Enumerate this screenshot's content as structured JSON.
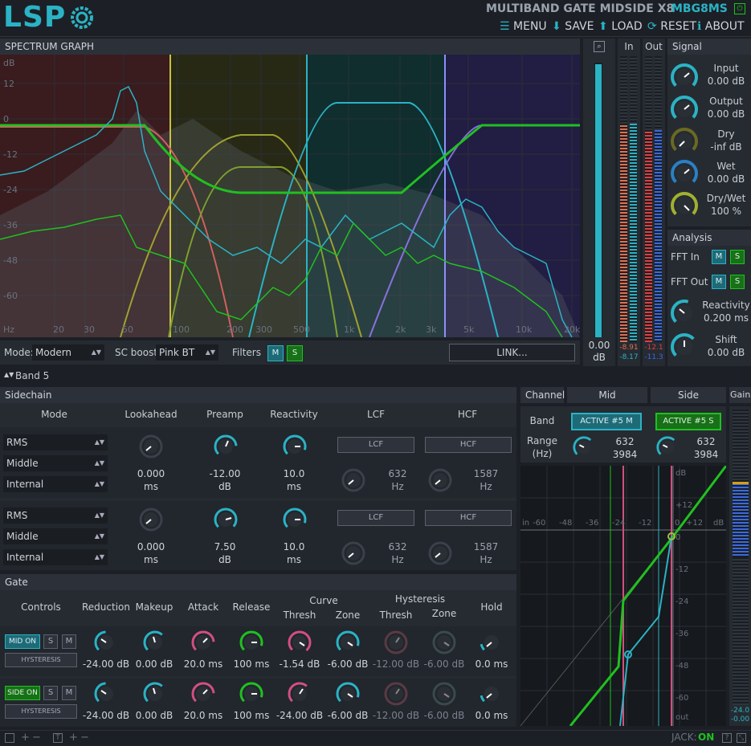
{
  "app": {
    "logo": "LSP",
    "title": "MULTIBAND GATE MIDSIDE X8",
    "code": "MBG8MS"
  },
  "menu": {
    "menu": "MENU",
    "save": "SAVE",
    "load": "LOAD",
    "reset": "RESET",
    "about": "ABOUT"
  },
  "graph": {
    "title": "SPECTRUM GRAPH",
    "db_unit": "dB",
    "y_ticks": [
      "12",
      "0",
      "-12",
      "-24",
      "-36",
      "-48",
      "-60"
    ],
    "hz_unit": "Hz",
    "x_ticks": [
      "20",
      "30",
      "50",
      "100",
      "200",
      "300",
      "500",
      "1k",
      "2k",
      "3k",
      "5k",
      "10k",
      "20k"
    ]
  },
  "gain_meter": {
    "value": "0.00",
    "unit": "dB"
  },
  "meters": {
    "in_label": "In",
    "out_label": "Out",
    "in_vals": [
      "-8.91",
      "-8.17"
    ],
    "out_vals": [
      "-12.1",
      "-11.3"
    ]
  },
  "signal": {
    "title": "Signal",
    "input": {
      "label": "Input",
      "value": "0.00 dB"
    },
    "output": {
      "label": "Output",
      "value": "0.00 dB"
    },
    "dry": {
      "label": "Dry",
      "value": "-inf dB"
    },
    "wet": {
      "label": "Wet",
      "value": "0.00 dB"
    },
    "drywet": {
      "label": "Dry/Wet",
      "value": "100 %"
    }
  },
  "analysis": {
    "title": "Analysis",
    "fft_in": "FFT In",
    "fft_out": "FFT Out",
    "m": "M",
    "s": "S",
    "reactivity": {
      "label": "Reactivity",
      "value": "0.200 ms"
    },
    "shift": {
      "label": "Shift",
      "value": "0.00 dB"
    }
  },
  "controls": {
    "mode_label": "Mode:",
    "mode_value": "Modern",
    "scboost_label": "SC boost:",
    "scboost_value": "Pink BT",
    "filters_label": "Filters",
    "m": "M",
    "s": "S",
    "link": "LINK..."
  },
  "band": {
    "label": "Band 5"
  },
  "sidechain": {
    "title": "Sidechain",
    "cols": {
      "mode": "Mode",
      "lookahead": "Lookahead",
      "preamp": "Preamp",
      "reactivity": "Reactivity",
      "lcf": "LCF",
      "hcf": "HCF"
    },
    "rows": [
      {
        "mode": "RMS",
        "source": "Middle",
        "type": "Internal",
        "lookahead": "0.000",
        "lookahead_unit": "ms",
        "preamp": "-12.00",
        "preamp_unit": "dB",
        "reactivity": "10.0",
        "reactivity_unit": "ms",
        "lcf_btn": "LCF",
        "hcf_btn": "HCF",
        "lcf_val": "632",
        "hcf_val": "1587",
        "hz": "Hz"
      },
      {
        "mode": "RMS",
        "source": "Middle",
        "type": "Internal",
        "lookahead": "0.000",
        "lookahead_unit": "ms",
        "preamp": "7.50",
        "preamp_unit": "dB",
        "reactivity": "10.0",
        "reactivity_unit": "ms",
        "lcf_btn": "LCF",
        "hcf_btn": "HCF",
        "lcf_val": "632",
        "hcf_val": "1587",
        "hz": "Hz"
      }
    ]
  },
  "channel": {
    "title": "Channel",
    "mid": "Mid",
    "side": "Side",
    "band_label": "Band",
    "range_label": "Range",
    "range_unit": "(Hz)",
    "mid_btn": "ACTIVE #5 M",
    "side_btn": "ACTIVE #5 S",
    "mid_lo": "632",
    "mid_hi": "3984",
    "side_lo": "632",
    "side_hi": "3984"
  },
  "gain_col": {
    "title": "Gain",
    "v1": "-24.0",
    "v2": "-0.00"
  },
  "gate": {
    "title": "Gate",
    "cols": {
      "controls": "Controls",
      "reduction": "Reduction",
      "makeup": "Makeup",
      "attack": "Attack",
      "release": "Release",
      "curve": "Curve",
      "hysteresis": "Hysteresis",
      "thresh": "Thresh",
      "zone": "Zone",
      "hold": "Hold"
    },
    "rows": [
      {
        "on": "MID ON",
        "s": "S",
        "m": "M",
        "hyst": "HYSTERESIS",
        "reduction": "-24.00 dB",
        "makeup": "0.00 dB",
        "attack": "20.0 ms",
        "release": "100 ms",
        "c_thresh": "-1.54 dB",
        "c_zone": "-6.00 dB",
        "h_thresh": "-12.00 dB",
        "h_zone": "-6.00 dB",
        "hold": "0.0 ms"
      },
      {
        "on": "SIDE ON",
        "s": "S",
        "m": "M",
        "hyst": "HYSTERESIS",
        "reduction": "-24.00 dB",
        "makeup": "0.00 dB",
        "attack": "20.0 ms",
        "release": "100 ms",
        "c_thresh": "-24.00 dB",
        "c_zone": "-6.00 dB",
        "h_thresh": "-12.00 dB",
        "h_zone": "-6.00 dB",
        "hold": "0.0 ms"
      }
    ]
  },
  "curve_graph": {
    "x_ticks": [
      "in",
      "-60",
      "-48",
      "-36",
      "-24",
      "-12",
      "0",
      "+12",
      "dB"
    ],
    "y_ticks": [
      "dB",
      "+12",
      "0",
      "-12",
      "-24",
      "-36",
      "-48",
      "-60",
      "out"
    ]
  },
  "status": {
    "jack_label": "JACK:",
    "jack_value": "ON"
  },
  "colors": {
    "accent": "#2ab3c4",
    "green": "#20c020",
    "pink": "#d05080",
    "bg": "#1c2026",
    "panel": "#262b32"
  }
}
